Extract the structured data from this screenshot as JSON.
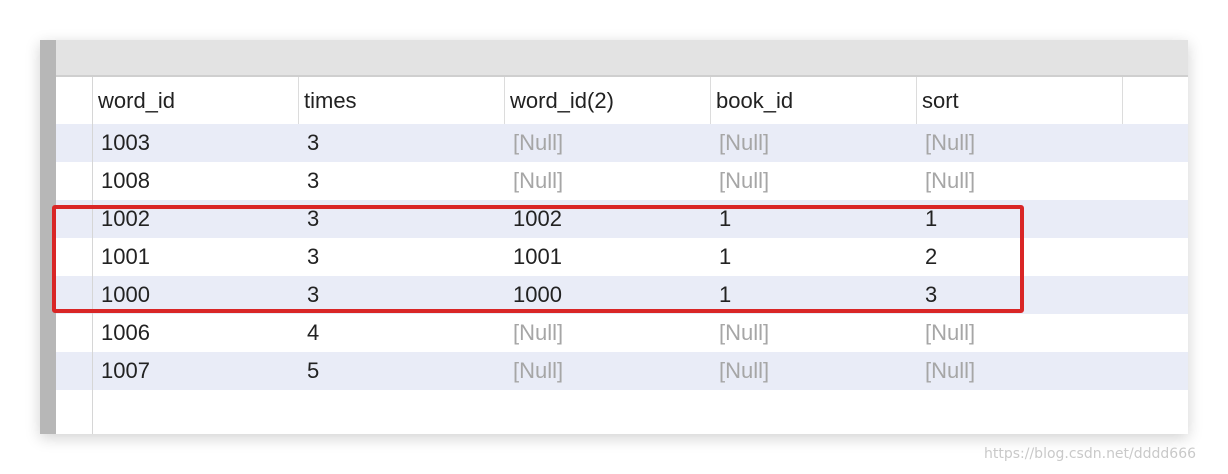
{
  "columns": [
    "word_id",
    "times",
    "word_id(2)",
    "book_id",
    "sort"
  ],
  "rows": [
    [
      "1003",
      "3",
      "[Null]",
      "[Null]",
      "[Null]"
    ],
    [
      "1008",
      "3",
      "[Null]",
      "[Null]",
      "[Null]"
    ],
    [
      "1002",
      "3",
      "1002",
      "1",
      "1"
    ],
    [
      "1001",
      "3",
      "1001",
      "1",
      "2"
    ],
    [
      "1000",
      "3",
      "1000",
      "1",
      "3"
    ],
    [
      "1006",
      "4",
      "[Null]",
      "[Null]",
      "[Null]"
    ],
    [
      "1007",
      "5",
      "[Null]",
      "[Null]",
      "[Null]"
    ]
  ],
  "highlighted_rows": [
    "1002",
    "1001",
    "1000"
  ],
  "colors": {
    "highlight": "#d92626",
    "alt_row": "#e9ecf7",
    "null_text": "#a6a6a6"
  },
  "watermark": "https://blog.csdn.net/dddd666"
}
